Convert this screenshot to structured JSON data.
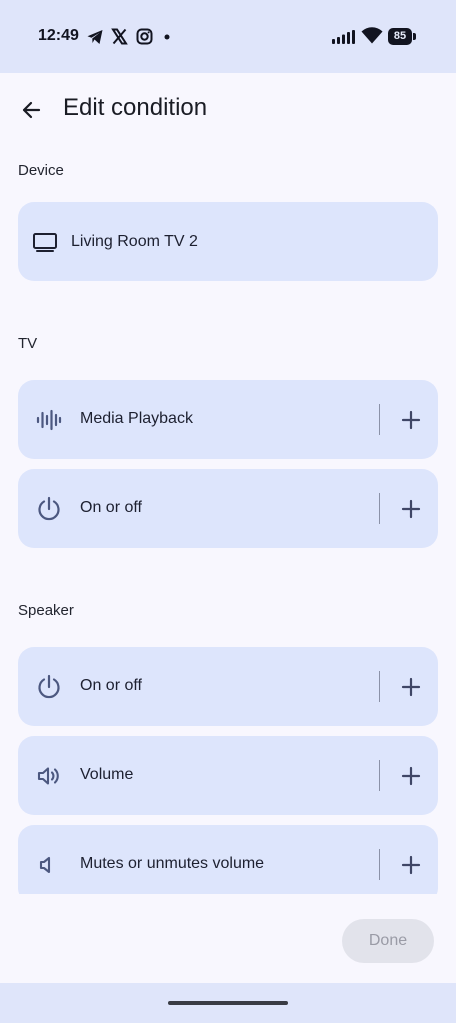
{
  "status_bar": {
    "time": "12:49",
    "battery": "85",
    "notification_icons": [
      "telegram-icon",
      "x-icon",
      "instagram-icon",
      "dot-icon"
    ],
    "system_icons": [
      "signal-icon",
      "wifi-icon",
      "battery-icon"
    ]
  },
  "header": {
    "title": "Edit condition"
  },
  "sections": {
    "device": {
      "title": "Device",
      "card": {
        "label": "Living Room TV 2",
        "icon": "tv-icon"
      }
    },
    "tv": {
      "title": "TV",
      "items": [
        {
          "label": "Media Playback",
          "icon": "audio-wave-icon"
        },
        {
          "label": "On or off",
          "icon": "power-icon"
        }
      ]
    },
    "speaker": {
      "title": "Speaker",
      "items": [
        {
          "label": "On or off",
          "icon": "power-icon"
        },
        {
          "label": "Volume",
          "icon": "volume-icon"
        },
        {
          "label": "Mutes or unmutes volume",
          "icon": "speaker-icon"
        }
      ]
    }
  },
  "footer": {
    "done_label": "Done",
    "done_enabled": false
  },
  "colors": {
    "background": "#f8f7fe",
    "status_bar": "#dfe5fa",
    "card": "#dde5fc",
    "icon": "#4c5880",
    "done_disabled_bg": "#e2e3eb",
    "done_disabled_text": "#9a9ba6"
  }
}
